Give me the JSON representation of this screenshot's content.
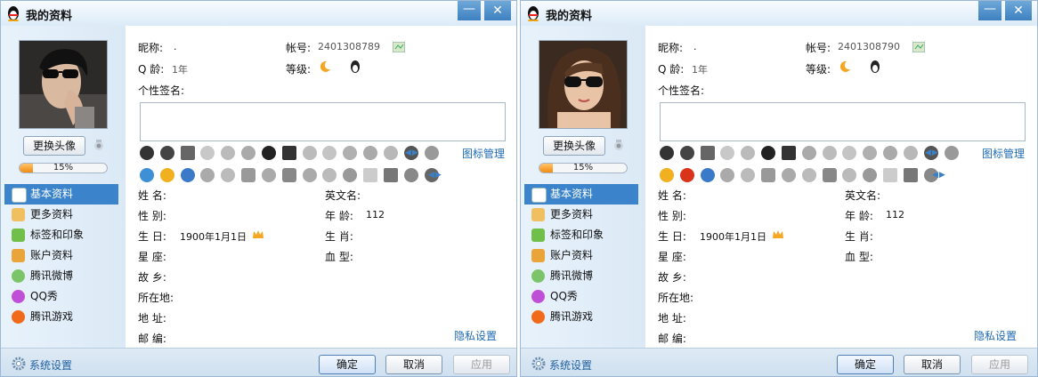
{
  "windows": [
    {
      "title": "我的资料",
      "avatar_alt": "avatar",
      "change_avatar": "更换头像",
      "progress_text": "15%",
      "progress_value": 0.15,
      "nickname_label": "昵称:",
      "nickname_value": ".",
      "account_label": "帐号:",
      "account_value": "2401308789",
      "qage_label": "Q 龄:",
      "qage_value": "1年",
      "level_label": "等级:",
      "signature_label": "个性签名:",
      "icon_manage": "图标管理",
      "fields_left": [
        {
          "label": "姓 名:",
          "value": ""
        },
        {
          "label": "性 别:",
          "value": ""
        },
        {
          "label": "生 日:",
          "value": "1900年1月1日"
        },
        {
          "label": "星 座:",
          "value": ""
        },
        {
          "label": "故 乡:",
          "value": ""
        },
        {
          "label": "所在地:",
          "value": ""
        },
        {
          "label": "地 址:",
          "value": ""
        },
        {
          "label": "邮 编:",
          "value": ""
        }
      ],
      "fields_right": [
        {
          "label": "英文名:",
          "value": ""
        },
        {
          "label": "年 龄:",
          "value": "112"
        },
        {
          "label": "生 肖:",
          "value": ""
        },
        {
          "label": "血 型:",
          "value": ""
        }
      ],
      "privacy": "隐私设置",
      "nav": [
        "基本资料",
        "更多资料",
        "标签和印象",
        "账户资料",
        "腾讯微博",
        "QQ秀",
        "腾讯游戏"
      ],
      "sys_settings": "系统设置",
      "ok": "确定",
      "cancel": "取消",
      "apply": "应用"
    },
    {
      "title": "我的资料",
      "avatar_alt": "avatar",
      "change_avatar": "更换头像",
      "progress_text": "15%",
      "progress_value": 0.15,
      "nickname_label": "昵称:",
      "nickname_value": ".",
      "account_label": "帐号:",
      "account_value": "2401308790",
      "qage_label": "Q 龄:",
      "qage_value": "1年",
      "level_label": "等级:",
      "signature_label": "个性签名:",
      "icon_manage": "图标管理",
      "fields_left": [
        {
          "label": "姓 名:",
          "value": ""
        },
        {
          "label": "性 别:",
          "value": ""
        },
        {
          "label": "生 日:",
          "value": "1900年1月1日"
        },
        {
          "label": "星 座:",
          "value": ""
        },
        {
          "label": "故 乡:",
          "value": ""
        },
        {
          "label": "所在地:",
          "value": ""
        },
        {
          "label": "地 址:",
          "value": ""
        },
        {
          "label": "邮 编:",
          "value": ""
        }
      ],
      "fields_right": [
        {
          "label": "英文名:",
          "value": ""
        },
        {
          "label": "年 龄:",
          "value": "112"
        },
        {
          "label": "生 肖:",
          "value": ""
        },
        {
          "label": "血 型:",
          "value": ""
        }
      ],
      "privacy": "隐私设置",
      "nav": [
        "基本资料",
        "更多资料",
        "标签和印象",
        "账户资料",
        "腾讯微博",
        "QQ秀",
        "腾讯游戏"
      ],
      "sys_settings": "系统设置",
      "ok": "确定",
      "cancel": "取消",
      "apply": "应用"
    }
  ],
  "colors": {
    "accent": "#3b84cc",
    "link": "#1e6ab3",
    "progress": "#f28b12"
  }
}
